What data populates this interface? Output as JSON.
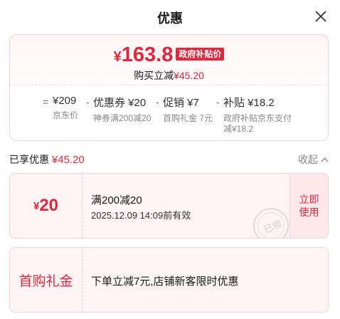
{
  "header": {
    "title": "优惠",
    "close_icon": "close-icon"
  },
  "summary": {
    "currency": "¥",
    "final_price": "163.8",
    "badge": "政府补贴价",
    "reduce_label": "购买立减",
    "reduce_amount": "¥45.20",
    "equals": "=",
    "terms": [
      {
        "main": "¥209",
        "sub": "京东价"
      },
      {
        "main": "优惠券 ¥20",
        "sub": "神券满200减20"
      },
      {
        "main": "促销 ¥7",
        "sub": "首购礼金 7元"
      },
      {
        "main": "补贴 ¥18.2",
        "sub_line1": "政府补贴京东支付",
        "sub_line2": "减¥18.2"
      }
    ],
    "minus": "-"
  },
  "enjoyed": {
    "label": "已享优惠",
    "amount": "¥45.20"
  },
  "collapse": {
    "label": "收起",
    "icon": "chevron-up-icon"
  },
  "coupons": [
    {
      "currency": "¥",
      "value": "20",
      "title": "满200减20",
      "expiry": "2025.12.09 14:09前有效",
      "action_line1": "立即",
      "action_line2": "使用",
      "stamp": "已领"
    },
    {
      "gift_label": "首购礼金",
      "title": "下单立减7元,店铺新客限时优惠"
    }
  ],
  "colors": {
    "accent": "#e4253a",
    "border": "#f4d2d6",
    "muted": "#8a8a8a"
  }
}
